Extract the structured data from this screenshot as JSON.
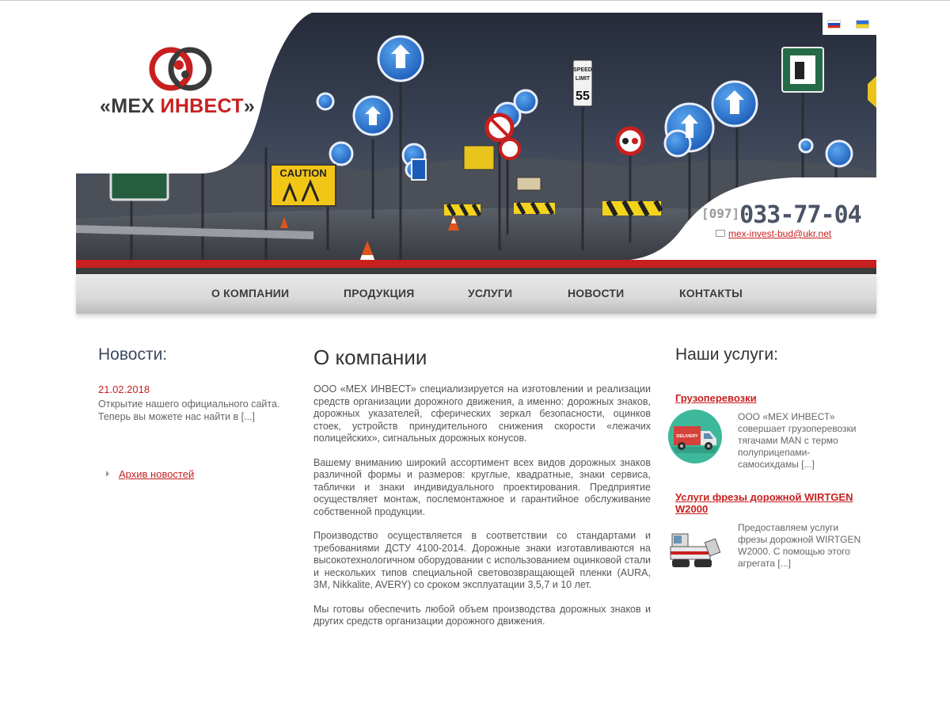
{
  "brand": {
    "quote_open": "«",
    "name_part1": "МЕХ ",
    "name_part2": "ИНВЕСТ",
    "quote_close": "»"
  },
  "header": {
    "phone_code": "[097]",
    "phone_number": "033-77-04",
    "email": "mex-invest-bud@ukr.net",
    "banner_signs": {
      "caution": "CAUTION",
      "speed_1": "SPEED",
      "speed_2": "LIMIT",
      "speed_3": "55"
    }
  },
  "languages": [
    {
      "code": "ru",
      "icon": "flag-ru-icon"
    },
    {
      "code": "ua",
      "icon": "flag-ua-icon"
    }
  ],
  "nav": {
    "items": [
      {
        "label": "О КОМПАНИИ"
      },
      {
        "label": "ПРОДУКЦИЯ"
      },
      {
        "label": "УСЛУГИ"
      },
      {
        "label": "НОВОСТИ"
      },
      {
        "label": "КОНТАКТЫ"
      }
    ]
  },
  "news": {
    "heading": "Новости:",
    "items": [
      {
        "date": "21.02.2018",
        "text": "Открытие нашего официального сайта. Теперь вы можете нас найти в [...]"
      }
    ],
    "archive_label": "Архив новостей"
  },
  "main": {
    "heading": "О компании",
    "paragraphs": [
      "ООО «МЕХ ИНВЕСТ» специализируется на изготовлении и реализации средств организации дорожного движения, а именно: дорожных знаков, дорожных указателей, сферических зеркал безопасности, оцинков стоек, устройств принудительного снижения скорости «лежачих полицейских», сигнальных дорожных конусов.",
      "Вашему вниманию широкий ассортимент всех видов дорожных знаков различной формы и размеров: круглые, квадратные, знаки сервиса, таблички и знаки индивидуального проектирования. Предприятие осуществляет монтаж, послемонтажное и гарантийное обслуживание собственной продукции.",
      "Производство осуществляется в соответствии со стандартами и требованиями ДСТУ 4100-2014. Дорожные знаки изготавливаются на высокотехнологичном оборудовании с использованием оцинковой стали и нескольких типов специальной световозвращающей пленки (AURA, 3M, Nikkalite, AVERY) со сроком эксплуатации 3,5,7 и 10 лет.",
      "Мы готовы обеспечить любой объем производства дорожных знаков и других средств организации дорожного движения."
    ]
  },
  "services": {
    "heading": "Наши услуги:",
    "items": [
      {
        "title": "Грузоперевозки",
        "text": "ООО «МЕХ ИНВЕСТ» совершает грузоперевозки тягачами MAN с термо полуприцепами-самосихдамы [...]",
        "icon": "delivery-truck-icon",
        "icon_label": "DELIVERY"
      },
      {
        "title": "Услуги фрезы дорожной WIRTGEN W2000",
        "text": "Предоставляем услуги фрезы дорожной WIRTGEN W2000. С помощью этого агрегата [...]",
        "icon": "road-milling-machine-icon"
      }
    ]
  },
  "colors": {
    "accent_red": "#c81f1f",
    "heading_blue": "#3c4a5c",
    "nav_text": "#3d3d3d",
    "banner_night": "#2a3142"
  }
}
